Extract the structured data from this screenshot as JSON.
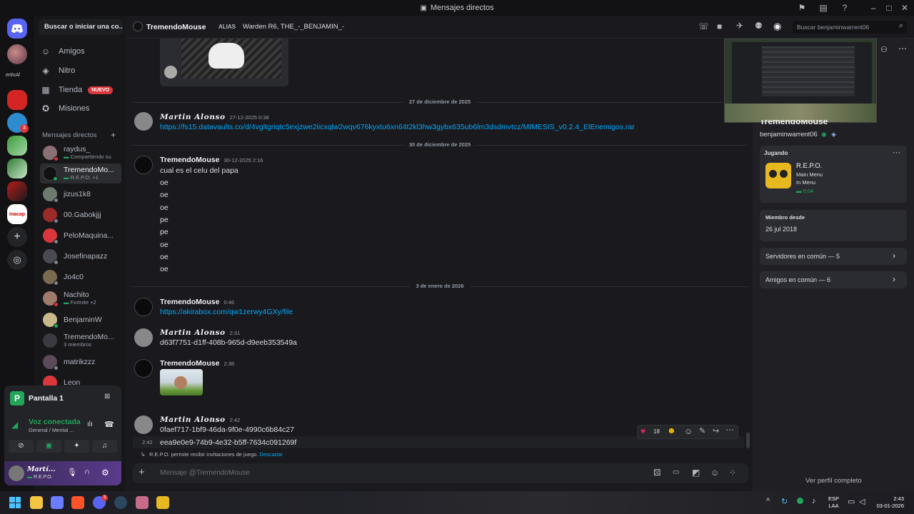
{
  "window": {
    "title": "Mensajes directos"
  },
  "sidebar": {
    "search_label": "Buscar o iniciar una co...",
    "nav": [
      {
        "label": "Amigos",
        "icon": "friends-icon"
      },
      {
        "label": "Nitro",
        "icon": "nitro-icon"
      },
      {
        "label": "Tienda",
        "icon": "shop-icon",
        "badge": "NUEVO"
      },
      {
        "label": "Misiones",
        "icon": "quests-icon"
      }
    ],
    "dm_header": "Mensajes directos",
    "dms": [
      {
        "name": "raydus_",
        "sub": "Compartiendo su"
      },
      {
        "name": "TremendoMo...",
        "sub": "R.E.P.O. +1"
      },
      {
        "name": "jizus1k8",
        "sub": ""
      },
      {
        "name": "00.Gabokjjj",
        "sub": ""
      },
      {
        "name": "PeloMaquina...",
        "sub": ""
      },
      {
        "name": "Josefinapazz",
        "sub": ""
      },
      {
        "name": "Jo4c0",
        "sub": ""
      },
      {
        "name": "Nachito",
        "sub": "Fortnite +2"
      },
      {
        "name": "BenjaminW",
        "sub": ""
      },
      {
        "name": "TremendoMo...",
        "sub": "3 miembros"
      },
      {
        "name": "matrikzzz",
        "sub": ""
      },
      {
        "name": "Leon",
        "sub": ""
      }
    ],
    "rail_label": "ertinAl",
    "rail_label2": "inacap",
    "rail_badge": "3"
  },
  "voice": {
    "stream_title": "Pantalla 1",
    "status": "Voz conectada",
    "channel": "General / Mental ...",
    "user_name": "Martí...",
    "user_sub": "R.E.P.O."
  },
  "header": {
    "name": "TremendoMouse",
    "alias_label": "ALIAS",
    "alias_value": "Warden R6, THE_-_BENJAMIN_-",
    "search_placeholder": "Buscar benjaminwarrent06"
  },
  "messages": {
    "date1": "27 de diciembre de 2025",
    "m1_author": "Martin Alonso",
    "m1_time": "27-12-2025 0:38",
    "m1_text": "https://fs15.datavaults.co/d/4vgltgriqtc5exjzwe2iicxqlw2wqv676kyxtu6xn64t2kl3hw3gybx635ub6lm3dsdmvtcz/MIMESIS_v0.2.4_ElEnemigos.rar",
    "date2": "30 de diciembre de 2025",
    "m2_author": "TremendoMouse",
    "m2_time": "30-12-2025 2:16",
    "m2_lines": [
      "cual es el celu del papa",
      "oe",
      "oe",
      "oe",
      "pe",
      "pe",
      "oe",
      "oe",
      "oe"
    ],
    "date3": "3 de enero de 2026",
    "m3_author": "TremendoMouse",
    "m3_time": "0:46",
    "m3_text": "https://akirabox.com/qw1zerwy4GXy/file",
    "m4_author": "Martin Alonso",
    "m4_time": "2:31",
    "m4_text": "d63f7751-d1ff-408b-965d-d9eeb353549a",
    "m5_author": "TremendoMouse",
    "m5_time": "2:38",
    "m6_author": "Martin Alonso",
    "m6_time": "2:42",
    "m6_text": "0faef717-1bf9-46da-9f0e-4990c6b84c27",
    "m7_time": "2:42",
    "m7_text": "eea9e0e9-74b9-4e32-b5ff-7634c091269f",
    "reaction_count": "18",
    "system_text": "R.E.P.O. permite recibir invitaciones de juego.",
    "system_action": "Descartar",
    "composer_placeholder": "Mensaje @TremendoMouse"
  },
  "profile": {
    "display_name": "TremendoMouse",
    "username": "benjaminwarrent06",
    "playing_label": "Jugando",
    "game_name": "R.E.P.O.",
    "game_detail1": "Main Menu",
    "game_detail2": "In Menu",
    "game_time": "0:04",
    "member_since_label": "Miembro desde",
    "member_since": "26 jul 2018",
    "servers_common": "Servidores en común — 5",
    "friends_common": "Amigos en común — 6",
    "view_full": "Ver perfil completo"
  },
  "taskbar": {
    "lang1": "ESP",
    "lang2": "LAA",
    "time": "2:43",
    "date": "03-01-2026",
    "discord_badge": "3"
  },
  "colors": {
    "accent": "#5865f2",
    "link": "#00a8fc",
    "green": "#23a55a",
    "red": "#da373c"
  }
}
